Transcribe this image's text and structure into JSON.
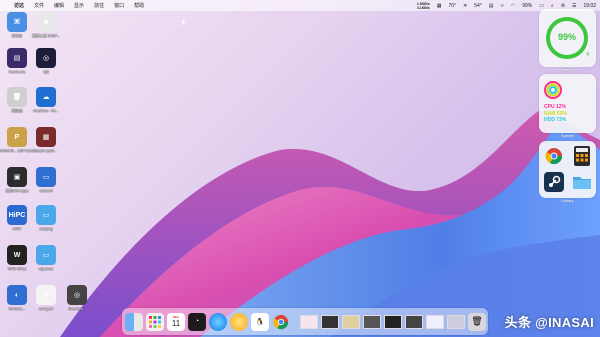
{
  "menubar": {
    "app_name": "访达",
    "menus": [
      "文件",
      "编辑",
      "显示",
      "前往",
      "窗口",
      "帮助"
    ],
    "net_up": "1.5KB/s",
    "net_down": "3.1KB/s",
    "temp": "70°",
    "temp2": "54°",
    "battery": "99%",
    "time": "19:02"
  },
  "desktop_icons": [
    {
      "label": "启动台",
      "color": "#4a90e2",
      "symbol": "⌘"
    },
    {
      "label": "截图工具 SSDP...",
      "color": "#e8e8e8",
      "symbol": "◉"
    },
    {
      "label": "DeskLoaa",
      "color": "#3b2a6a",
      "symbol": "▤"
    },
    {
      "label": "QQ",
      "color": "#1d1d3a",
      "symbol": "◎"
    },
    {
      "label": "回收站",
      "color": "#cfcfcf",
      "symbol": "🗑"
    },
    {
      "label": "OneDrive - Pe...",
      "color": "#1e6fd1",
      "symbol": "☁"
    },
    {
      "label": "PLAYERUN... BATTLEGR...",
      "color": "#c9a24a",
      "symbol": "P"
    },
    {
      "label": "win10 sploit...",
      "color": "#7a2a2a",
      "symbol": "▦"
    },
    {
      "label": "系统XXX.apps",
      "color": "#2c2c2c",
      "symbol": "▣"
    },
    {
      "label": "cache.lif",
      "color": "#2f6fd1",
      "symbol": "▭"
    },
    {
      "label": "HiPC",
      "color": "#2a6ad1",
      "symbol": "HiPC"
    },
    {
      "label": "sanyang",
      "color": "#4aa8e8",
      "symbol": "▭"
    },
    {
      "label": "WPS Office",
      "color": "#222222",
      "symbol": "W"
    },
    {
      "label": "cqLamos",
      "color": "#4aa8e8",
      "symbol": "▭"
    },
    {
      "label": "Bit-Gate...",
      "color": "#2f6fd1",
      "symbol": "◐"
    },
    {
      "label": "config.txt",
      "color": "#f4f4f4",
      "symbol": "✎"
    },
    {
      "label": "Overlook...",
      "color": "#444444",
      "symbol": "◎"
    }
  ],
  "widgets": {
    "battery": {
      "percent": "99%",
      "label": "Battery",
      "level": 0.99,
      "color": "#3ec73e"
    },
    "system": {
      "label": "System",
      "cpu": "CPU 12%",
      "ram": "RAM 53%",
      "hdd": "HDD 73%",
      "cpu_color": "#ff2d8a",
      "ram_color": "#c8dd1a",
      "hdd_color": "#28c8e0"
    },
    "library": {
      "label": "Library"
    }
  },
  "watermark": "头条 @INASAI",
  "dock": {
    "calendar_day": "11",
    "calendar_month": "DEC"
  }
}
